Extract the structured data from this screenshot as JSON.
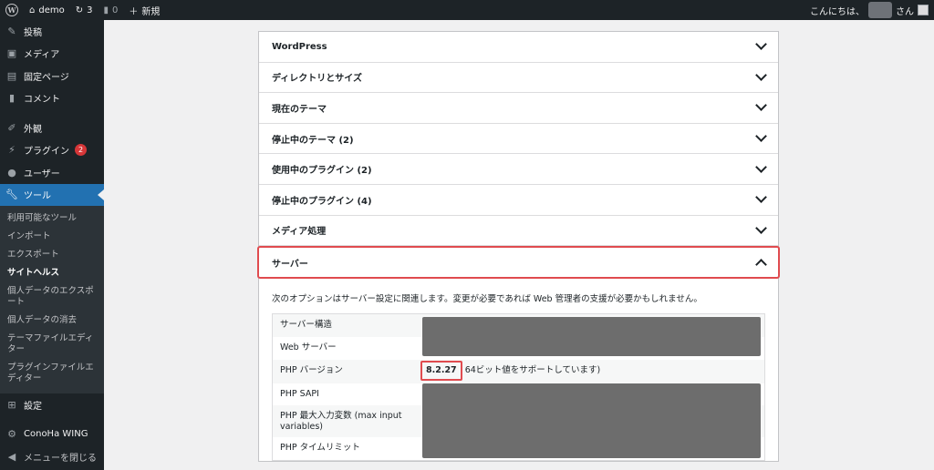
{
  "adminbar": {
    "site_name": "demo",
    "updates_count": "3",
    "comments_count": "0",
    "new_label": "新規",
    "greeting": "こんにちは、",
    "san": "さん"
  },
  "sidebar": {
    "items_top": [
      {
        "label": "投稿",
        "icon": "pin-icon"
      },
      {
        "label": "メディア",
        "icon": "media-icon"
      },
      {
        "label": "固定ページ",
        "icon": "page-icon"
      },
      {
        "label": "コメント",
        "icon": "comment-icon"
      }
    ],
    "items_mid": [
      {
        "label": "外観",
        "icon": "brush-icon"
      },
      {
        "label": "プラグイン",
        "icon": "plugin-icon",
        "badge": "2"
      },
      {
        "label": "ユーザー",
        "icon": "user-icon"
      },
      {
        "label": "ツール",
        "icon": "wrench-icon",
        "active": true
      }
    ],
    "submenu": [
      "利用可能なツール",
      "インポート",
      "エクスポート",
      "サイトヘルス",
      "個人データのエクスポート",
      "個人データの消去",
      "テーマファイルエディター",
      "プラグインファイルエディター"
    ],
    "settings": "設定",
    "conoha": "ConoHa WING",
    "collapse": "メニューを閉じる"
  },
  "accordion": [
    "WordPress",
    "ディレクトリとサイズ",
    "現在のテーマ",
    "停止中のテーマ (2)",
    "使用中のプラグイン (2)",
    "停止中のプラグイン (4)",
    "メディア処理"
  ],
  "server": {
    "title": "サーバー",
    "description": "次のオプションはサーバー設定に関連します。変更が必要であれば Web 管理者の支援が必要かもしれません。",
    "rows": [
      {
        "label": "サーバー構造"
      },
      {
        "label": "Web サーバー"
      },
      {
        "label": "PHP バージョン",
        "version": "8.2.27",
        "note": "64ビット値をサポートしています)"
      },
      {
        "label": "PHP SAPI"
      },
      {
        "label": "PHP 最大入力変数 (max input variables)"
      },
      {
        "label": "PHP タイムリミット"
      }
    ]
  }
}
